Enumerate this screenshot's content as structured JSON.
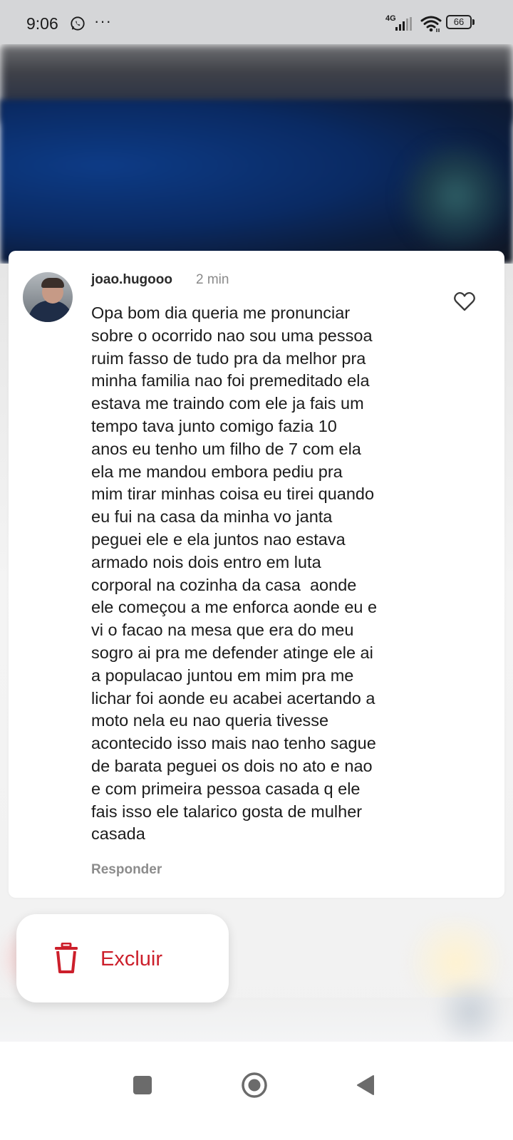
{
  "status_bar": {
    "time": "9:06",
    "more_indicator": "···",
    "network": "4G",
    "battery": "66",
    "icons": [
      "whatsapp-icon",
      "signal-icon",
      "wifi-icon",
      "battery-icon"
    ]
  },
  "comment": {
    "username": "joao.hugooo",
    "time_ago": "2 min",
    "text": "Opa bom dia queria me pronunciar\nsobre o ocorrido nao sou uma pessoa\nruim fasso de tudo pra da melhor pra\nminha familia nao foi premeditado ela\nestava me traindo com ele ja fais um\ntempo tava junto comigo fazia 10\nanos eu tenho um filho de 7 com ela\nela me mandou embora pediu pra\nmim tirar minhas coisa eu tirei quando\neu fui na casa da minha vo janta\npeguei ele e ela juntos nao estava\narmado nois dois entro em luta\ncorporal na cozinha da casa  aonde\nele começou a me enforca aonde eu e\nvi o facao na mesa que era do meu\nsogro ai pra me defender atinge ele ai\na populacao juntou em mim pra me\nlichar foi aonde eu acabei acertando a\nmoto nela eu nao queria tivesse\nacontecido isso mais nao tenho sague\nde barata peguei os dois no ato e nao\ne com primeira pessoa casada q ele\nfais isso ele talarico gosta de mulher\ncasada",
    "reply_label": "Responder",
    "like_icon": "heart-outline-icon"
  },
  "context_menu": {
    "delete_label": "Excluir",
    "delete_icon": "trash-icon",
    "delete_color": "#cc1f2b"
  },
  "nav_bar": {
    "icons": [
      "recents-square-icon",
      "home-circle-icon",
      "back-triangle-icon"
    ]
  }
}
